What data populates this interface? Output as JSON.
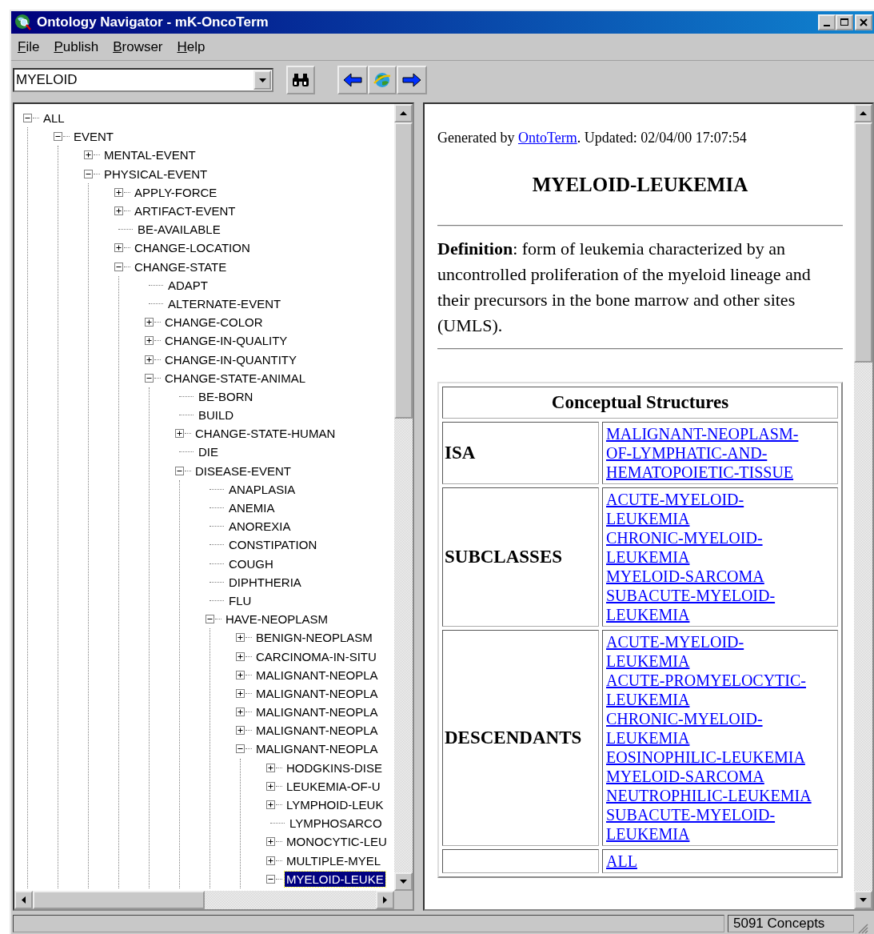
{
  "window": {
    "title": "Ontology Navigator - mK-OncoTerm"
  },
  "menu": [
    {
      "label": "File"
    },
    {
      "label": "Publish"
    },
    {
      "label": "Browser"
    },
    {
      "label": "Help"
    }
  ],
  "search": {
    "value": "MYELOID"
  },
  "tree": [
    {
      "label": "ALL",
      "kind": "branch",
      "expanded": true,
      "selected": false,
      "children": [
        {
          "label": "EVENT",
          "kind": "branch",
          "expanded": true,
          "selected": false,
          "children": [
            {
              "label": "MENTAL-EVENT",
              "kind": "branch",
              "expanded": false,
              "selected": false
            },
            {
              "label": "PHYSICAL-EVENT",
              "kind": "branch",
              "expanded": true,
              "selected": false,
              "children": [
                {
                  "label": "APPLY-FORCE",
                  "kind": "branch",
                  "expanded": false,
                  "selected": false
                },
                {
                  "label": "ARTIFACT-EVENT",
                  "kind": "branch",
                  "expanded": false,
                  "selected": false
                },
                {
                  "label": "BE-AVAILABLE",
                  "kind": "leaf",
                  "selected": false
                },
                {
                  "label": "CHANGE-LOCATION",
                  "kind": "branch",
                  "expanded": false,
                  "selected": false
                },
                {
                  "label": "CHANGE-STATE",
                  "kind": "branch",
                  "expanded": true,
                  "selected": false,
                  "children": [
                    {
                      "label": "ADAPT",
                      "kind": "leaf",
                      "selected": false
                    },
                    {
                      "label": "ALTERNATE-EVENT",
                      "kind": "leaf",
                      "selected": false
                    },
                    {
                      "label": "CHANGE-COLOR",
                      "kind": "branch",
                      "expanded": false,
                      "selected": false
                    },
                    {
                      "label": "CHANGE-IN-QUALITY",
                      "kind": "branch",
                      "expanded": false,
                      "selected": false
                    },
                    {
                      "label": "CHANGE-IN-QUANTITY",
                      "kind": "branch",
                      "expanded": false,
                      "selected": false
                    },
                    {
                      "label": "CHANGE-STATE-ANIMAL",
                      "kind": "branch",
                      "expanded": true,
                      "selected": false,
                      "children": [
                        {
                          "label": "BE-BORN",
                          "kind": "leaf",
                          "selected": false
                        },
                        {
                          "label": "BUILD",
                          "kind": "leaf",
                          "selected": false
                        },
                        {
                          "label": "CHANGE-STATE-HUMAN",
                          "kind": "branch",
                          "expanded": false,
                          "selected": false
                        },
                        {
                          "label": "DIE",
                          "kind": "leaf",
                          "selected": false
                        },
                        {
                          "label": "DISEASE-EVENT",
                          "kind": "branch",
                          "expanded": true,
                          "selected": false,
                          "children": [
                            {
                              "label": "ANAPLASIA",
                              "kind": "leaf",
                              "selected": false
                            },
                            {
                              "label": "ANEMIA",
                              "kind": "leaf",
                              "selected": false
                            },
                            {
                              "label": "ANOREXIA",
                              "kind": "leaf",
                              "selected": false
                            },
                            {
                              "label": "CONSTIPATION",
                              "kind": "leaf",
                              "selected": false
                            },
                            {
                              "label": "COUGH",
                              "kind": "leaf",
                              "selected": false
                            },
                            {
                              "label": "DIPHTHERIA",
                              "kind": "leaf",
                              "selected": false
                            },
                            {
                              "label": "FLU",
                              "kind": "leaf",
                              "selected": false
                            },
                            {
                              "label": "HAVE-NEOPLASM",
                              "kind": "branch",
                              "expanded": true,
                              "selected": false,
                              "children": [
                                {
                                  "label": "BENIGN-NEOPLASM",
                                  "kind": "branch",
                                  "expanded": false,
                                  "selected": false
                                },
                                {
                                  "label": "CARCINOMA-IN-SITU",
                                  "kind": "branch",
                                  "expanded": false,
                                  "selected": false
                                },
                                {
                                  "label": "MALIGNANT-NEOPLA",
                                  "kind": "branch",
                                  "expanded": false,
                                  "selected": false
                                },
                                {
                                  "label": "MALIGNANT-NEOPLA",
                                  "kind": "branch",
                                  "expanded": false,
                                  "selected": false
                                },
                                {
                                  "label": "MALIGNANT-NEOPLA",
                                  "kind": "branch",
                                  "expanded": false,
                                  "selected": false
                                },
                                {
                                  "label": "MALIGNANT-NEOPLA",
                                  "kind": "branch",
                                  "expanded": false,
                                  "selected": false
                                },
                                {
                                  "label": "MALIGNANT-NEOPLA",
                                  "kind": "branch",
                                  "expanded": true,
                                  "selected": false,
                                  "children": [
                                    {
                                      "label": "HODGKINS-DISE",
                                      "kind": "branch",
                                      "expanded": false,
                                      "selected": false
                                    },
                                    {
                                      "label": "LEUKEMIA-OF-U",
                                      "kind": "branch",
                                      "expanded": false,
                                      "selected": false
                                    },
                                    {
                                      "label": "LYMPHOID-LEUK",
                                      "kind": "branch",
                                      "expanded": false,
                                      "selected": false
                                    },
                                    {
                                      "label": "LYMPHOSARCO",
                                      "kind": "leaf",
                                      "selected": false
                                    },
                                    {
                                      "label": "MONOCYTIC-LEU",
                                      "kind": "branch",
                                      "expanded": false,
                                      "selected": false
                                    },
                                    {
                                      "label": "MULTIPLE-MYEL",
                                      "kind": "branch",
                                      "expanded": false,
                                      "selected": false
                                    },
                                    {
                                      "label": "MYELOID-LEUKE",
                                      "kind": "branch",
                                      "expanded": true,
                                      "selected": true
                                    }
                                  ]
                                }
                              ]
                            }
                          ]
                        }
                      ]
                    }
                  ]
                }
              ]
            }
          ]
        }
      ]
    }
  ],
  "document": {
    "generated": {
      "prefix": "Generated by ",
      "link": "OntoTerm",
      "suffix": ". Updated: 02/04/00 17:07:54"
    },
    "title": "MYELOID-LEUKEMIA",
    "definition": "**Definition**: form of leukemia characterized by an uncontrolled proliferation of the myeloid lineage and their precursors in the bone marrow and other sites (UMLS).",
    "table": {
      "caption": "Conceptual Structures",
      "rows": [
        {
          "label": "ISA",
          "links": [
            "MALIGNANT-NEOPLASM-OF-LYMPHATIC-AND-HEMATOPOIETIC-TISSUE"
          ]
        },
        {
          "label": "SUBCLASSES",
          "links": [
            "ACUTE-MYELOID-LEUKEMIA",
            "CHRONIC-MYELOID-LEUKEMIA",
            "MYELOID-SARCOMA",
            "SUBACUTE-MYELOID-LEUKEMIA"
          ]
        },
        {
          "label": "DESCENDANTS",
          "links": [
            "ACUTE-MYELOID-LEUKEMIA",
            "ACUTE-PROMYELOCYTIC-LEUKEMIA",
            "CHRONIC-MYELOID-LEUKEMIA",
            "EOSINOPHILIC-LEUKEMIA",
            "MYELOID-SARCOMA",
            "NEUTROPHILIC-LEUKEMIA",
            "SUBACUTE-MYELOID-LEUKEMIA"
          ]
        },
        {
          "links": [
            "ALL"
          ]
        }
      ]
    }
  },
  "status_bar": {
    "count": "5091 Concepts"
  }
}
